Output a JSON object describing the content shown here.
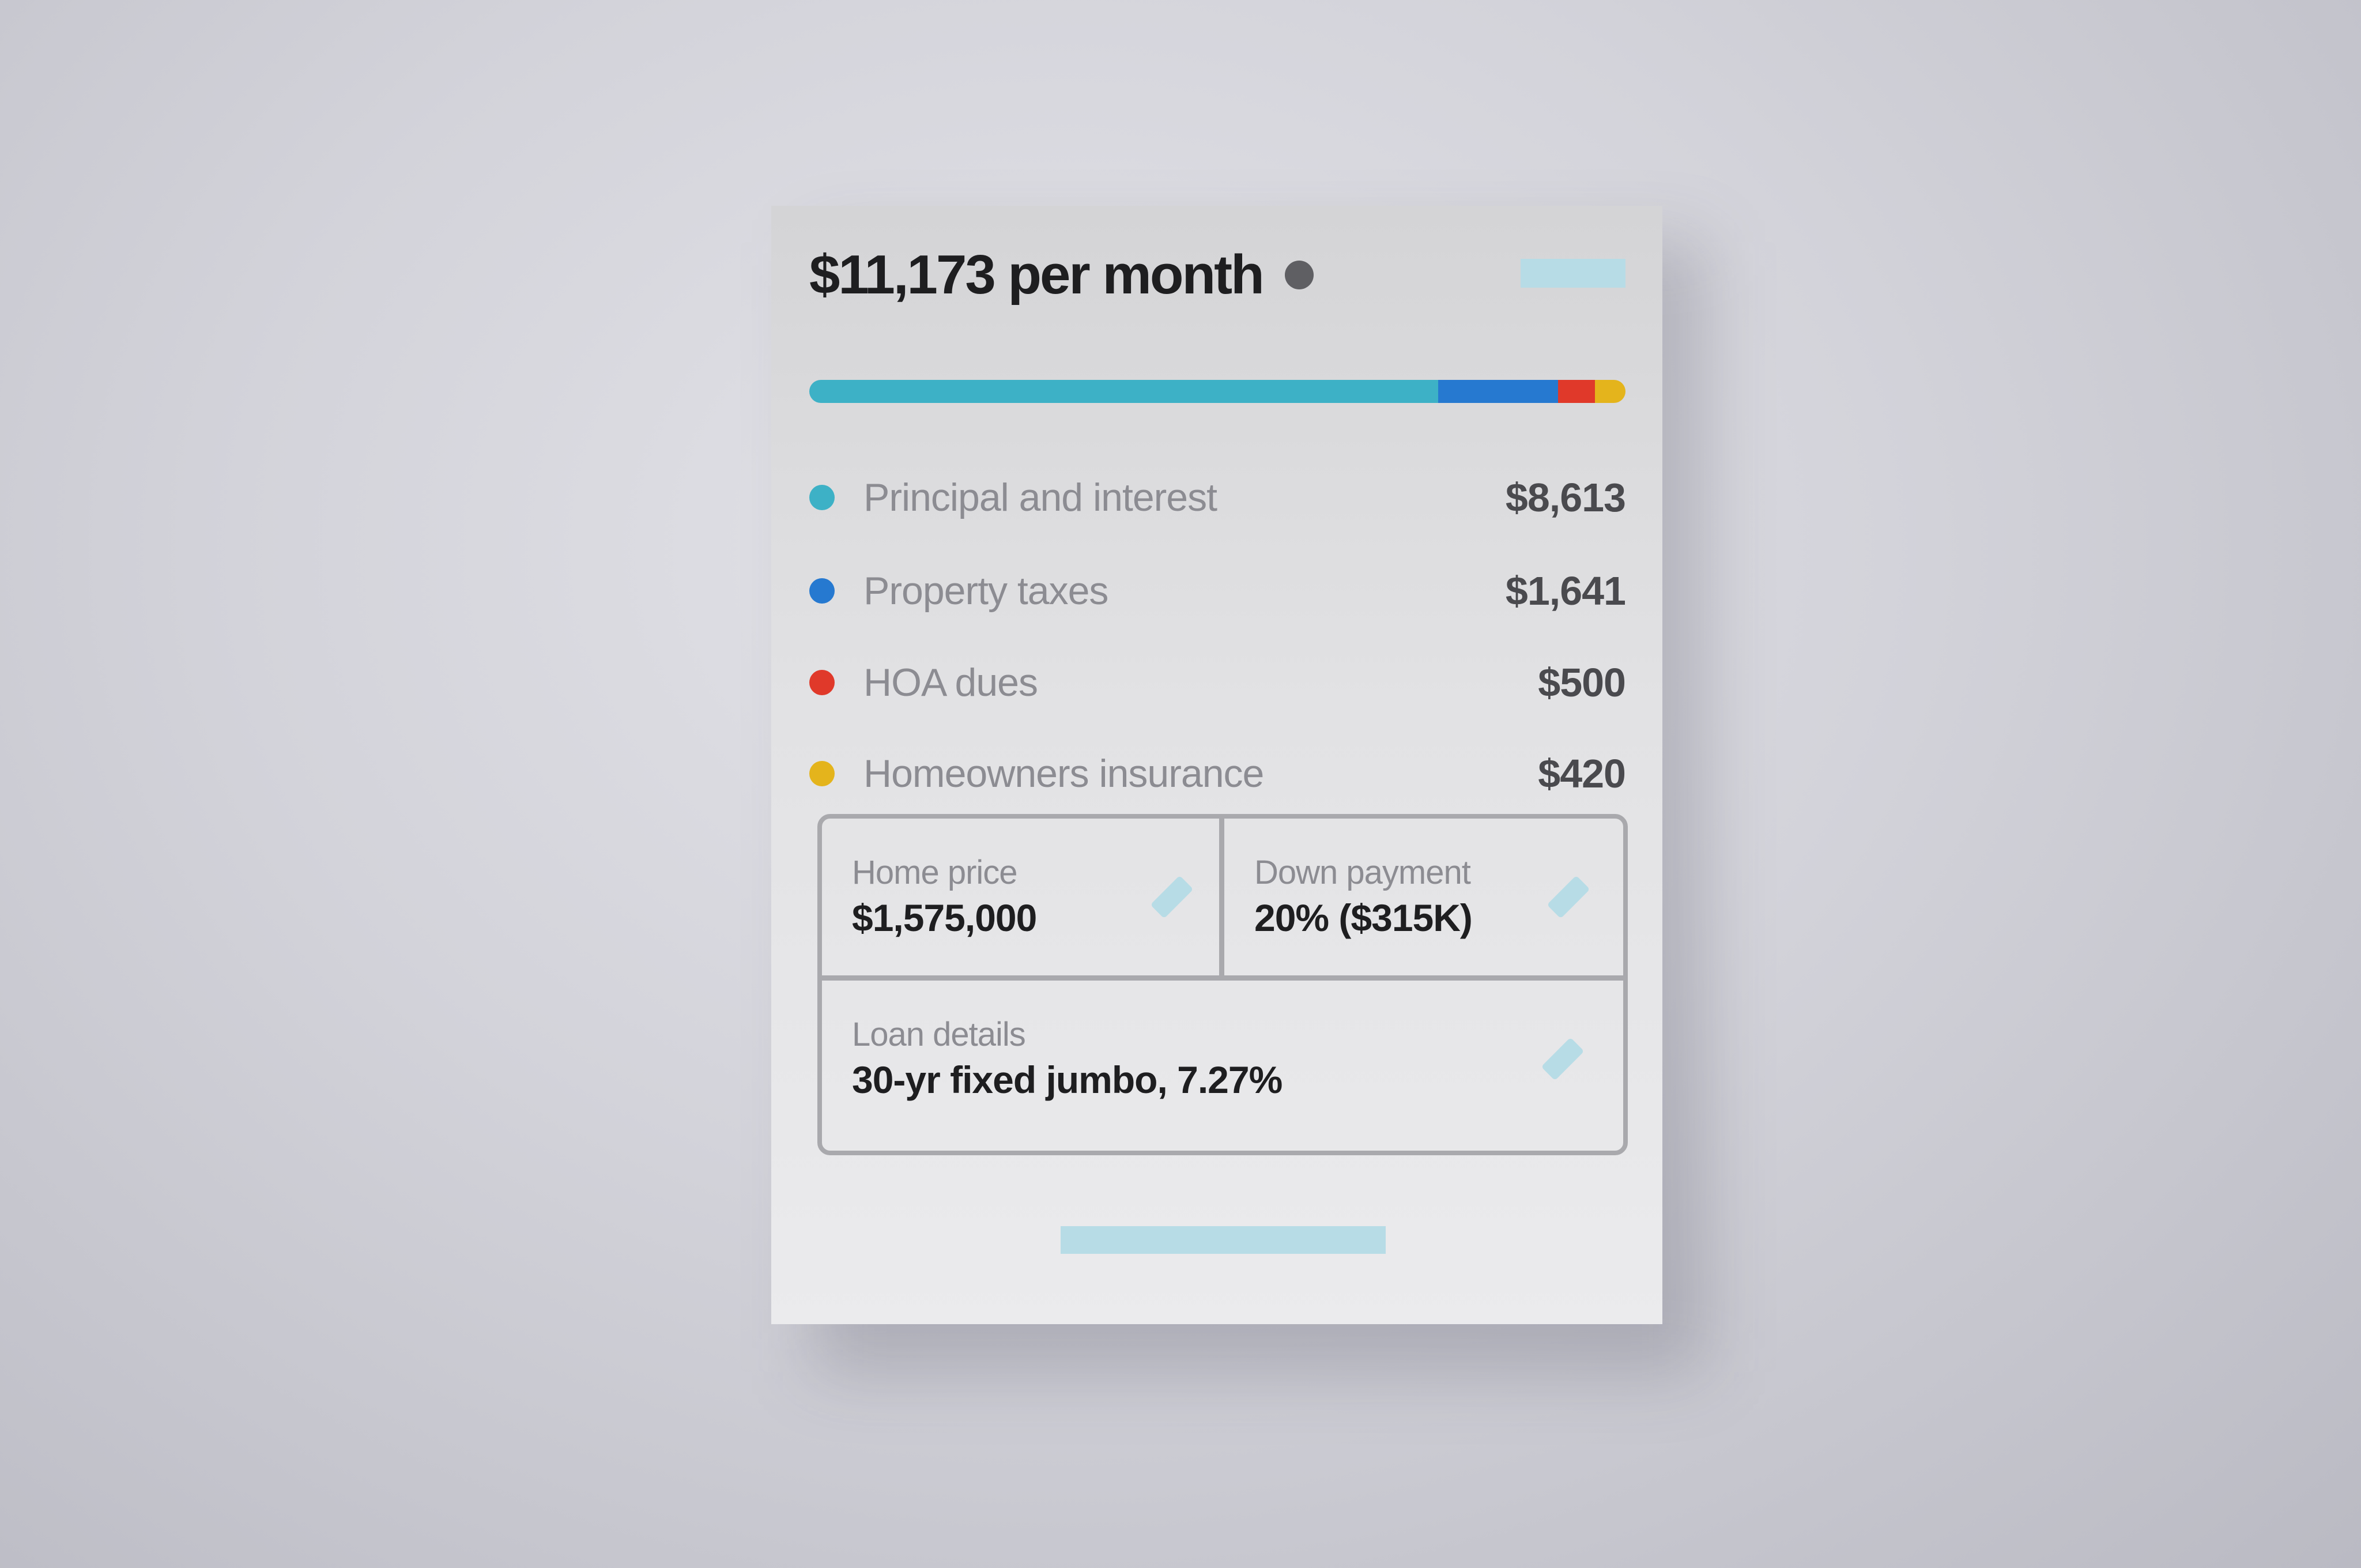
{
  "summary": {
    "title": "$11,173 per month",
    "info_icon": "info-dot-icon",
    "action_placeholder": ""
  },
  "breakdown": {
    "items": [
      {
        "label": "Principal and interest",
        "value": "$8,613",
        "amount": 8613,
        "color": "#3db1c6"
      },
      {
        "label": "Property taxes",
        "value": "$1,641",
        "amount": 1641,
        "color": "#2679d0"
      },
      {
        "label": "HOA dues",
        "value": "$500",
        "amount": 500,
        "color": "#e0392a"
      },
      {
        "label": "Homeowners insurance",
        "value": "$420",
        "amount": 420,
        "color": "#e4b41c"
      }
    ]
  },
  "inputs": {
    "home_price": {
      "label": "Home price",
      "value": "$1,575,000",
      "icon": "edit-pencil-icon"
    },
    "down_payment": {
      "label": "Down payment",
      "value": "20% ($315K)",
      "icon": "edit-pencil-icon"
    },
    "loan_details": {
      "label": "Loan details",
      "value": "30-yr fixed jumbo, 7.27%",
      "icon": "edit-pencil-icon"
    }
  },
  "colors": {
    "accent_placeholder": "#b7dce6",
    "border": "#a9a9ad"
  }
}
